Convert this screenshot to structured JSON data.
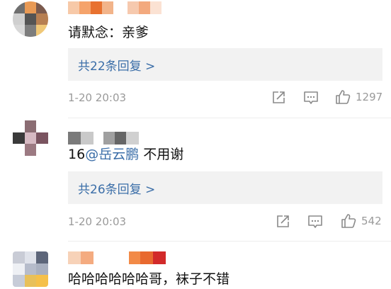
{
  "comments": [
    {
      "text": "请默念：亲爹",
      "reply_label": "共22条回复 >",
      "timestamp": "1-20 20:03",
      "likes": "1297",
      "avatar_colors": [
        "#6f6f6f",
        "#e99a55",
        "#7b5a4d",
        "#cfcfcf",
        "#545454",
        "#b77f52",
        "#d8d8d8",
        "#7d7d7d",
        "#f0c878"
      ],
      "name_block_colors": [
        "#f7c9a8",
        "#f5a36b",
        "#e8712f",
        "#f2b48a",
        "#ffffff",
        "#f6c9ae",
        "#f3a97e",
        "#fbe2d3"
      ]
    },
    {
      "text_prefix": "16",
      "mention": "@岳云鹏",
      "text_suffix": " 不用谢",
      "reply_label": "共26条回复 >",
      "timestamp": "1-20 20:03",
      "likes": "542",
      "avatar_colors": [
        "#ffffff",
        "#8b6d73",
        "#ffffff",
        "#3a3a3a",
        "#d6b9c2",
        "#7a5460",
        "#ffffff",
        "#9c7a82",
        "#ffffff"
      ],
      "name_block_colors": [
        "#7a7a7a",
        "#c9c9c9",
        "#ffffff",
        "#a0a0a0",
        "#666666",
        "#d0d0d0"
      ]
    },
    {
      "text": "哈哈哈哈哈哈哥，袜子不错",
      "avatar_colors": [
        "#c9ccd6",
        "#dfe2ea",
        "#5d667a",
        "#eef0f4",
        "#b6bccb",
        "#a9b0c0",
        "#c7ccd8",
        "#e8c05a",
        "#f5c04a"
      ],
      "name_block_colors": [
        "#f7d2b8",
        "#f4ab80",
        "#ffffff",
        "#f28a47",
        "#e8692f",
        "#d22a2a"
      ]
    }
  ],
  "icons": {
    "share": "share-icon",
    "comment": "comment-icon",
    "like": "thumbs-up-icon"
  }
}
